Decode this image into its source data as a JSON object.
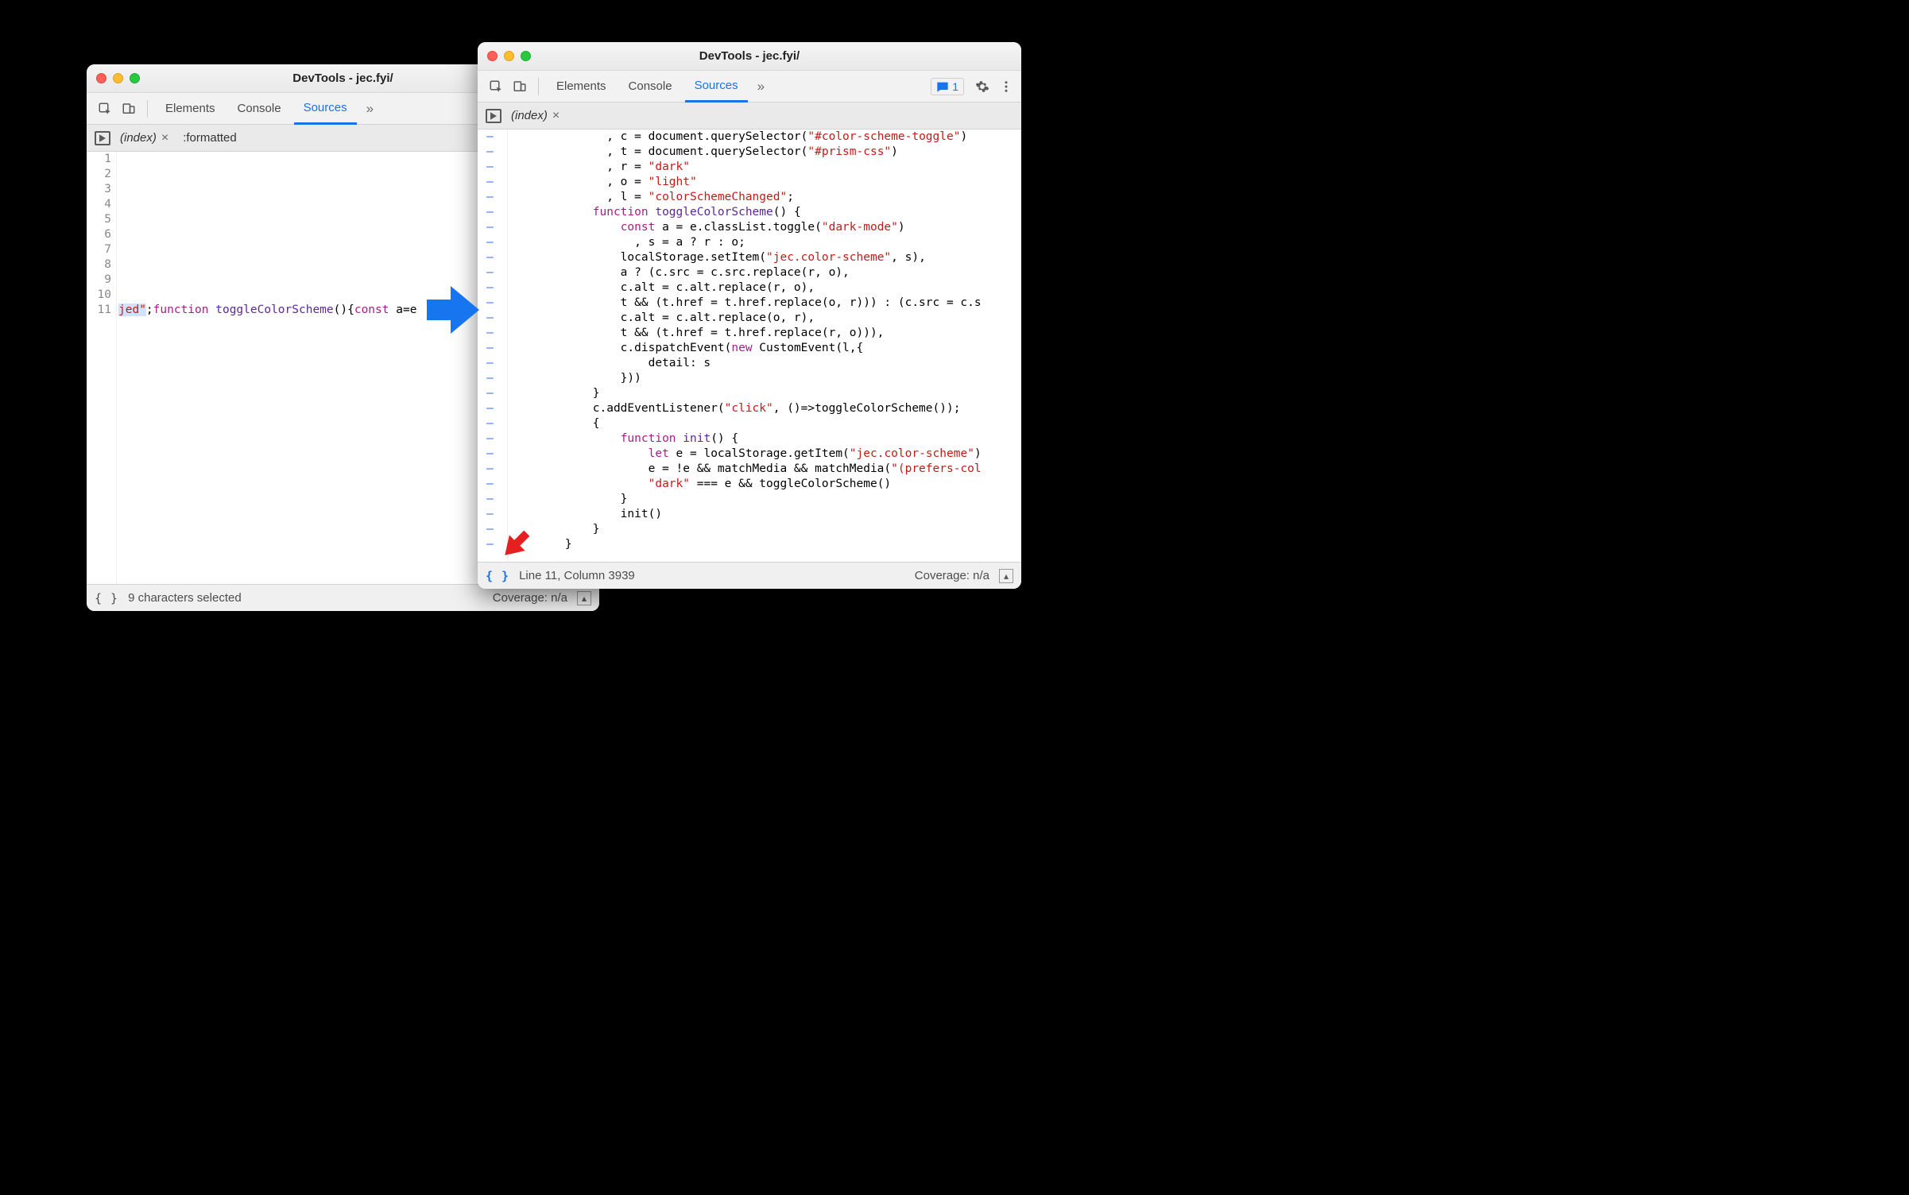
{
  "app_title": "DevTools - jec.fyi/",
  "panels": {
    "elements": "Elements",
    "console": "Console",
    "sources": "Sources"
  },
  "issues_count": "1",
  "left": {
    "tab1": "(index)",
    "tab2": ":formatted",
    "lines": [
      "1",
      "2",
      "3",
      "4",
      "5",
      "6",
      "7",
      "8",
      "9",
      "10",
      "11"
    ],
    "code_suffix_str": "jed\"",
    "code_kw_function": "function",
    "code_fname": "toggleColorScheme",
    "code_parens": "(){",
    "code_kw_const": "const",
    "code_tail": " a=e",
    "status_left": "9 characters selected",
    "coverage": "Coverage: n/a"
  },
  "right": {
    "tab1": "(index)",
    "status_left": "Line 11, Column 3939",
    "coverage": "Coverage: n/a",
    "lines": [
      [
        {
          "t": "              , c = document.querySelector("
        },
        {
          "t": "\"#color-scheme-toggle\"",
          "c": "str"
        },
        {
          "t": ")"
        }
      ],
      [
        {
          "t": "              , t = document.querySelector("
        },
        {
          "t": "\"#prism-css\"",
          "c": "str"
        },
        {
          "t": ")"
        }
      ],
      [
        {
          "t": "              , r = "
        },
        {
          "t": "\"dark\"",
          "c": "str"
        }
      ],
      [
        {
          "t": "              , o = "
        },
        {
          "t": "\"light\"",
          "c": "str"
        }
      ],
      [
        {
          "t": "              , l = "
        },
        {
          "t": "\"colorSchemeChanged\"",
          "c": "str"
        },
        {
          "t": ";"
        }
      ],
      [
        {
          "t": "            "
        },
        {
          "t": "function",
          "c": "kw"
        },
        {
          "t": " "
        },
        {
          "t": "toggleColorScheme",
          "c": "fn"
        },
        {
          "t": "() {"
        }
      ],
      [
        {
          "t": "                "
        },
        {
          "t": "const",
          "c": "kw"
        },
        {
          "t": " a = e.classList.toggle("
        },
        {
          "t": "\"dark-mode\"",
          "c": "str"
        },
        {
          "t": ")"
        }
      ],
      [
        {
          "t": "                  , s = a ? r : o;"
        }
      ],
      [
        {
          "t": "                localStorage.setItem("
        },
        {
          "t": "\"jec.color-scheme\"",
          "c": "str"
        },
        {
          "t": ", s),"
        }
      ],
      [
        {
          "t": "                a ? (c.src = c.src.replace(r, o),"
        }
      ],
      [
        {
          "t": "                c.alt = c.alt.replace(r, o),"
        }
      ],
      [
        {
          "t": "                t && (t.href = t.href.replace(o, r))) : (c.src = c.s"
        }
      ],
      [
        {
          "t": "                c.alt = c.alt.replace(o, r),"
        }
      ],
      [
        {
          "t": "                t && (t.href = t.href.replace(r, o))),"
        }
      ],
      [
        {
          "t": "                c.dispatchEvent("
        },
        {
          "t": "new",
          "c": "new"
        },
        {
          "t": " CustomEvent(l,{"
        }
      ],
      [
        {
          "t": "                    detail: s"
        }
      ],
      [
        {
          "t": "                }))"
        }
      ],
      [
        {
          "t": "            }"
        }
      ],
      [
        {
          "t": "            c.addEventListener("
        },
        {
          "t": "\"click\"",
          "c": "str"
        },
        {
          "t": ", ()=>toggleColorScheme());"
        }
      ],
      [
        {
          "t": "            {"
        }
      ],
      [
        {
          "t": "                "
        },
        {
          "t": "function",
          "c": "kw"
        },
        {
          "t": " "
        },
        {
          "t": "init",
          "c": "fn"
        },
        {
          "t": "() {"
        }
      ],
      [
        {
          "t": "                    "
        },
        {
          "t": "let",
          "c": "kw"
        },
        {
          "t": " e = localStorage.getItem("
        },
        {
          "t": "\"jec.color-scheme\"",
          "c": "str"
        },
        {
          "t": ")"
        }
      ],
      [
        {
          "t": "                    e = !e && matchMedia && matchMedia("
        },
        {
          "t": "\"(prefers-col",
          "c": "str"
        }
      ],
      [
        {
          "t": "                    "
        },
        {
          "t": "\"dark\"",
          "c": "str"
        },
        {
          "t": " === e && toggleColorScheme()"
        }
      ],
      [
        {
          "t": "                }"
        }
      ],
      [
        {
          "t": "                init()"
        }
      ],
      [
        {
          "t": "            }"
        }
      ],
      [
        {
          "t": "        }"
        }
      ]
    ]
  }
}
